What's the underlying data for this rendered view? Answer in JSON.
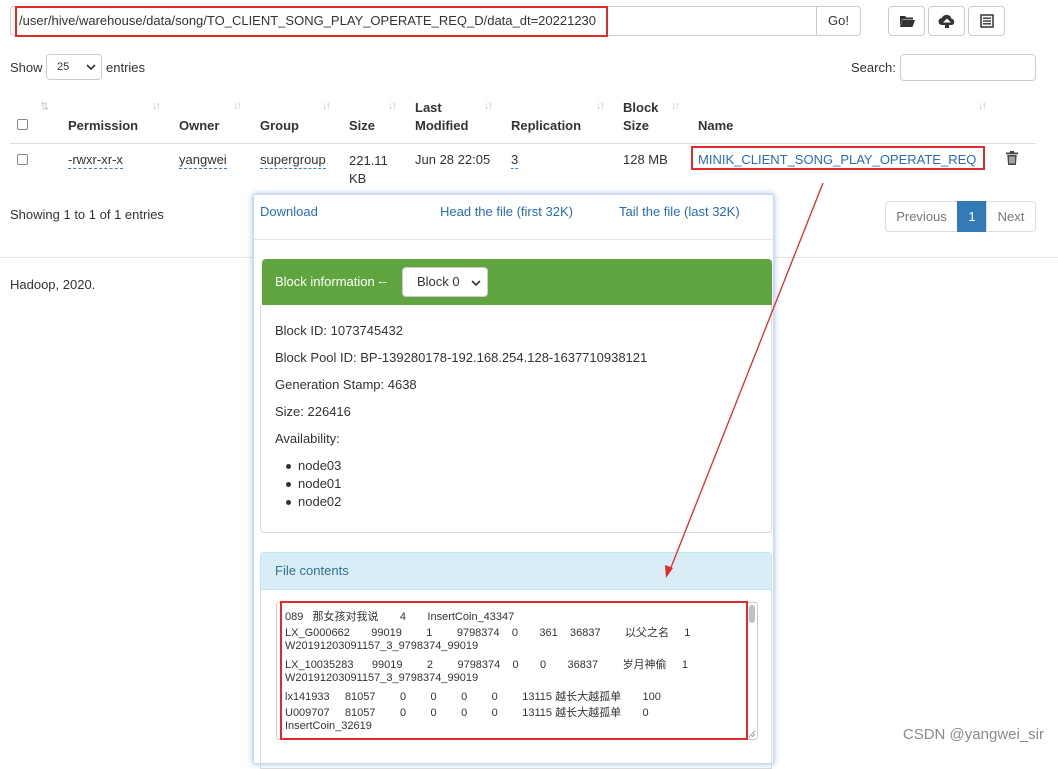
{
  "path": {
    "value": "/user/hive/warehouse/data/song/TO_CLIENT_SONG_PLAY_OPERATE_REQ_D/data_dt=20221230",
    "go_label": "Go!"
  },
  "toolbar": {
    "icons": [
      "folder-open-icon",
      "cloud-upload-icon",
      "list-icon"
    ]
  },
  "table_controls": {
    "show_label": "Show",
    "entries_value": "25",
    "entries_label": "entries",
    "search_label": "Search:"
  },
  "table": {
    "headers": {
      "permission": "Permission",
      "owner": "Owner",
      "group": "Group",
      "size": "Size",
      "last": "Last",
      "modified": "Modified",
      "replication": "Replication",
      "block": "Block",
      "block_size": "Size",
      "name": "Name"
    },
    "row": {
      "permission": "-rwxr-xr-x",
      "owner": "yangwei",
      "group": "supergroup",
      "size_line1": "221.11",
      "size_line2": "KB",
      "modified": "Jun 28 22:05",
      "replication": "3",
      "block_size": "128 MB",
      "name": "MINIK_CLIENT_SONG_PLAY_OPERATE_REQ"
    }
  },
  "pagination": {
    "showing": "Showing 1 to 1 of 1 entries",
    "previous": "Previous",
    "current": "1",
    "next": "Next"
  },
  "footer": {
    "text": "Hadoop, 2020."
  },
  "popup": {
    "download": "Download",
    "head": "Head the file (first 32K)",
    "tail": "Tail the file (last 32K)",
    "block_info_label": "Block information --",
    "block_select": "Block 0",
    "block_id": "Block ID: 1073745432",
    "block_pool": "Block Pool ID: BP-139280178-192.168.254.128-1637710938121",
    "gen_stamp": "Generation Stamp: 4638",
    "size": "Size: 226416",
    "availability": "Availability:",
    "nodes": [
      "node03",
      "node01",
      "node02"
    ],
    "file_contents_label": "File contents",
    "content_lines": [
      "089   那女孩对我说       4       InsertCoin_43347",
      "LX_G000662       99019        1        9798374    0       361    36837        以父之名     1",
      "W20191203091157_3_9798374_99019",
      "LX_10035283      99019        2        9798374    0       0       36837        岁月神偷     1",
      "W20191203091157_3_9798374_99019",
      "lx141933     81057        0        0        0        0        13115 越长大越孤单       100",
      "U009707     81057        0        0        0        0        13115 越长大越孤单       0",
      "InsertCoin_32619"
    ]
  },
  "watermark": "CSDN @yangwei_sir",
  "colors": {
    "accent_red": "#e02b2b",
    "link_blue": "#2a6cb3",
    "panel_green": "#5fa43f",
    "panel_blue": "#d9edf7",
    "pager_active": "#337ab7"
  }
}
